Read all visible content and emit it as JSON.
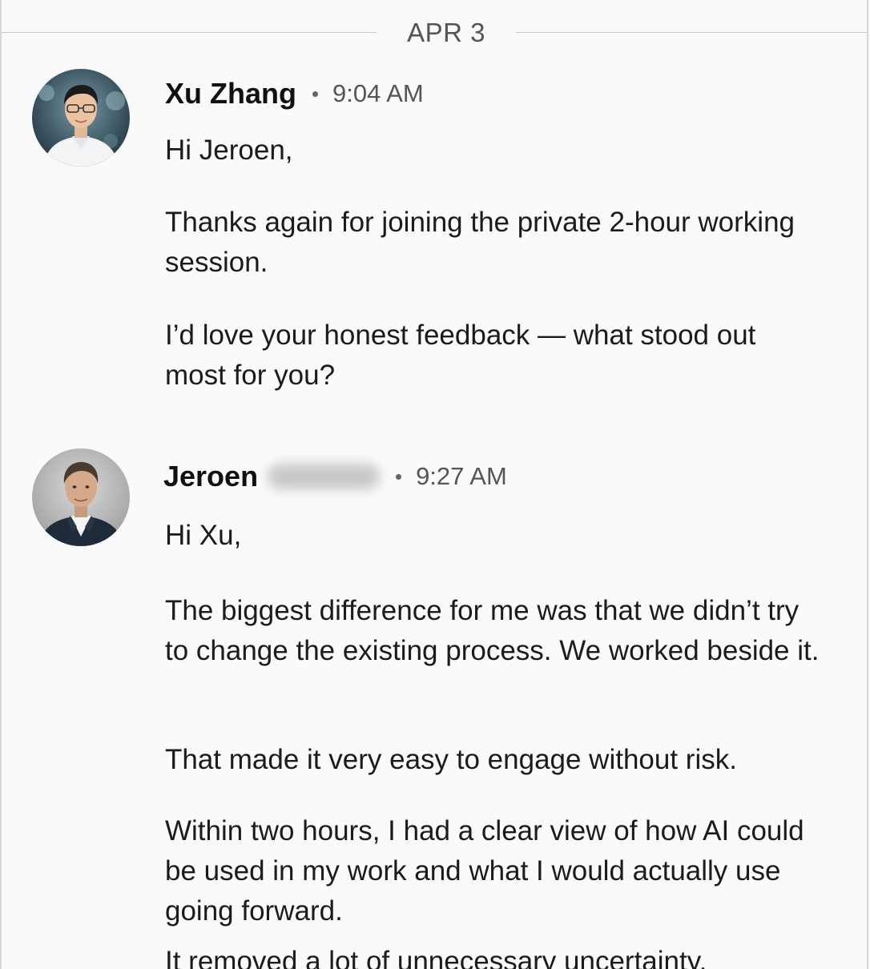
{
  "date_divider": "APR 3",
  "messages": [
    {
      "sender": "Xu Zhang",
      "time": "9:04 AM",
      "paragraphs": [
        "Hi Jeroen,",
        "Thanks again for joining the private 2-hour working session.",
        "I’d love your honest feedback — what stood out most for you?"
      ]
    },
    {
      "sender": "Jeroen",
      "time": "9:27 AM",
      "paragraphs": [
        "Hi Xu,",
        "The biggest difference for me was that we didn’t try to change the existing process. We worked beside it.",
        "That made it very easy to engage without risk.",
        "Within two hours, I had a clear view of how AI could be used in my work and what I would actually use going forward.",
        "It removed a lot of unnecessary uncertainty."
      ]
    }
  ]
}
